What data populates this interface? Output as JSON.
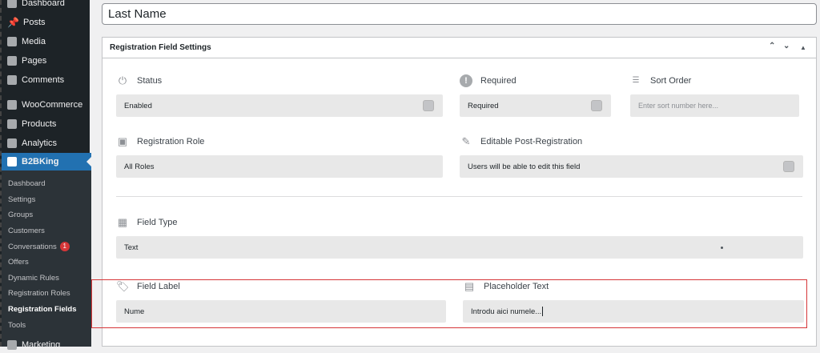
{
  "sidebar": {
    "top_items": [
      "Dashboard",
      "Posts",
      "Media",
      "Pages",
      "Comments",
      "WooCommerce",
      "Products",
      "Analytics",
      "B2BKing",
      "Marketing"
    ],
    "active": "B2BKing",
    "submenu": [
      "Dashboard",
      "Settings",
      "Groups",
      "Customers",
      "Conversations",
      "Offers",
      "Dynamic Rules",
      "Registration Roles",
      "Registration Fields",
      "Tools"
    ],
    "current_sub": "Registration Fields",
    "conversations_badge": "1"
  },
  "title_value": "Last Name",
  "panel": {
    "title": "Registration Field Settings",
    "fields": {
      "status": {
        "label": "Status",
        "value": "Enabled"
      },
      "required": {
        "label": "Required",
        "value": "Required"
      },
      "sort_order": {
        "label": "Sort Order",
        "placeholder": "Enter sort number here..."
      },
      "registration_role": {
        "label": "Registration Role",
        "value": "All Roles"
      },
      "editable": {
        "label": "Editable Post-Registration",
        "value": "Users will be able to edit this field"
      },
      "field_type": {
        "label": "Field Type",
        "value": "Text"
      },
      "field_label": {
        "label": "Field Label",
        "value": "Nume"
      },
      "placeholder_text": {
        "label": "Placeholder Text",
        "value": "Introdu aici numele..."
      }
    }
  },
  "colors": {
    "admin_bg": "#1d2327",
    "active": "#2271b1",
    "highlight": "#d63638"
  }
}
